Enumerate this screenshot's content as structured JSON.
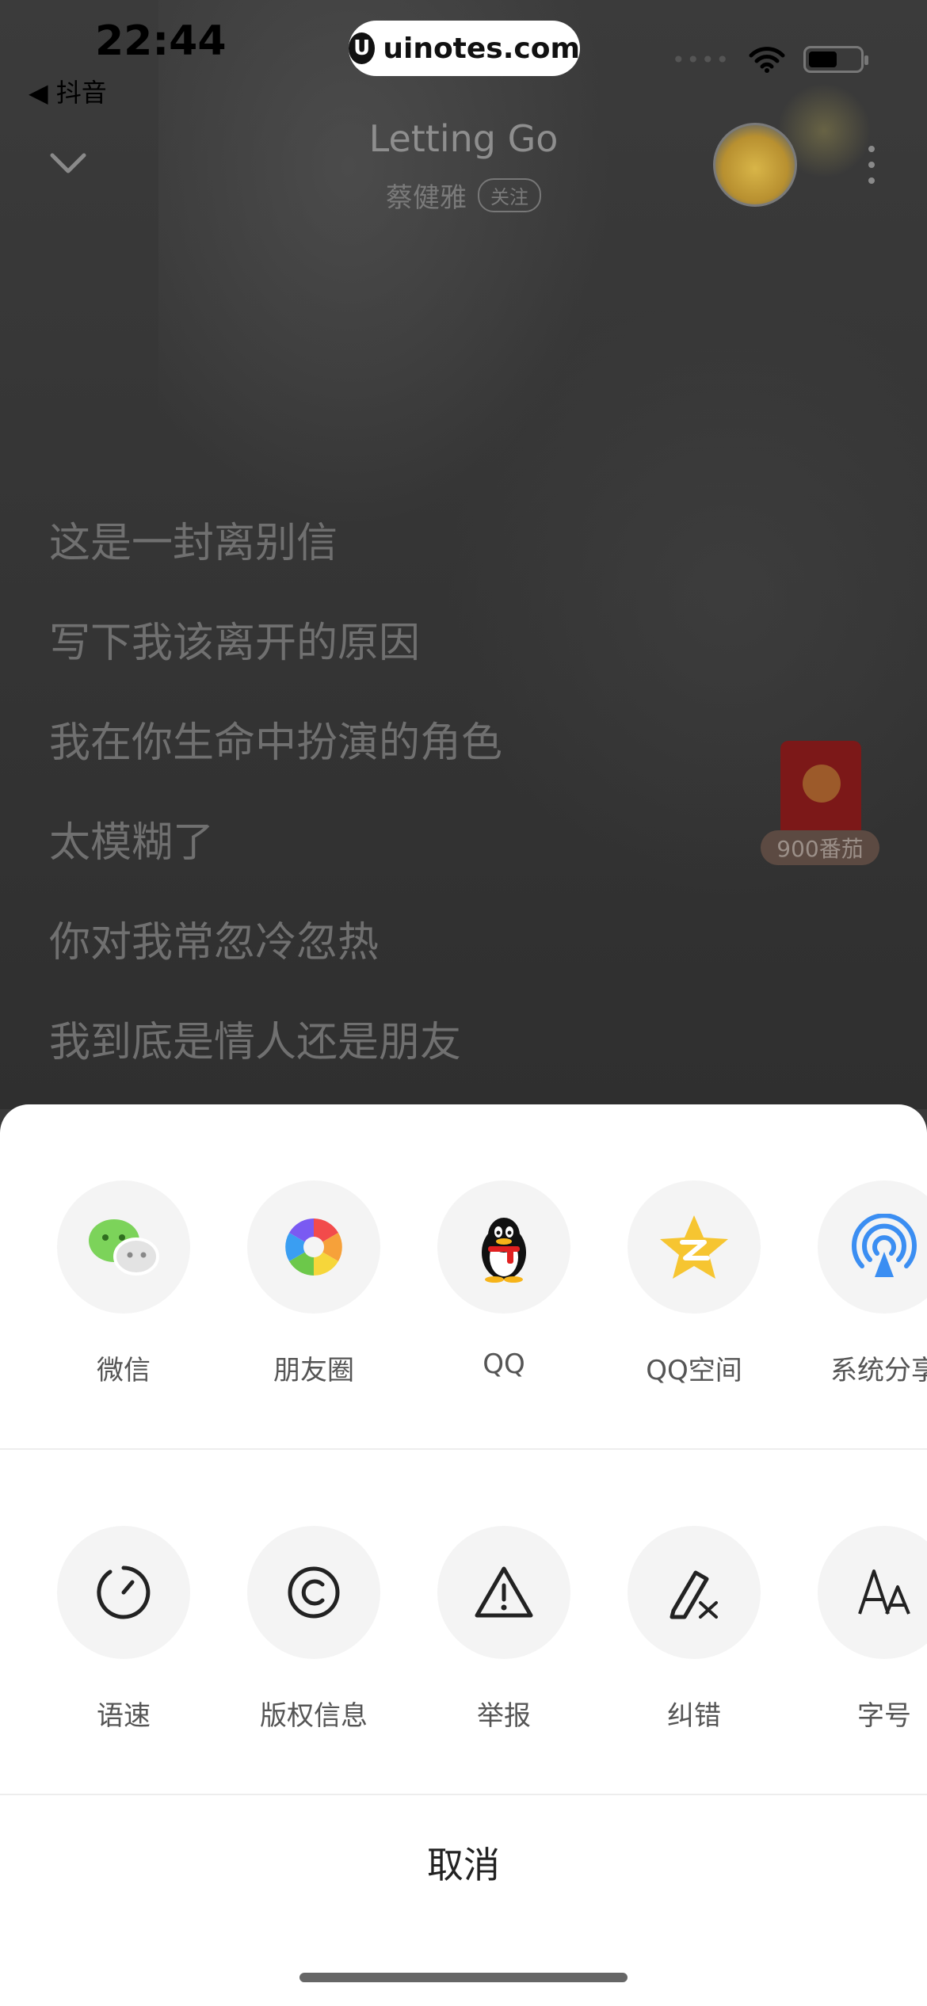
{
  "status_bar": {
    "time": "22:44",
    "back_app": "◀ 抖音",
    "url": "uinotes.com",
    "signal": "••••",
    "battery_level": 0.55
  },
  "player": {
    "title": "Letting Go",
    "artist": "蔡健雅",
    "follow_label": "关注"
  },
  "lyrics": [
    "这是一封离别信",
    "写下我该离开的原因",
    "我在你生命中扮演的角色",
    "太模糊了",
    "你对我常忽冷忽热",
    "我到底是情人还是朋友"
  ],
  "red_packet": {
    "label": "900番茄"
  },
  "share_row": [
    {
      "label": "微信",
      "icon": "wechat-icon"
    },
    {
      "label": "朋友圈",
      "icon": "moments-icon"
    },
    {
      "label": "QQ",
      "icon": "qq-icon"
    },
    {
      "label": "QQ空间",
      "icon": "qzone-icon"
    },
    {
      "label": "系统分享",
      "icon": "airdrop-icon"
    }
  ],
  "action_row": [
    {
      "label": "语速",
      "icon": "speed-icon"
    },
    {
      "label": "版权信息",
      "icon": "copyright-icon"
    },
    {
      "label": "举报",
      "icon": "warning-icon"
    },
    {
      "label": "纠错",
      "icon": "correction-icon"
    },
    {
      "label": "字号",
      "icon": "font-size-icon"
    }
  ],
  "cancel_label": "取消",
  "colors": {
    "sheet_bg": "#ffffff",
    "icon_circle": "#f4f4f4",
    "wechat_green": "#7cd35a",
    "qzone_yellow": "#f6c531",
    "airdrop_blue": "#3b8ef2"
  }
}
